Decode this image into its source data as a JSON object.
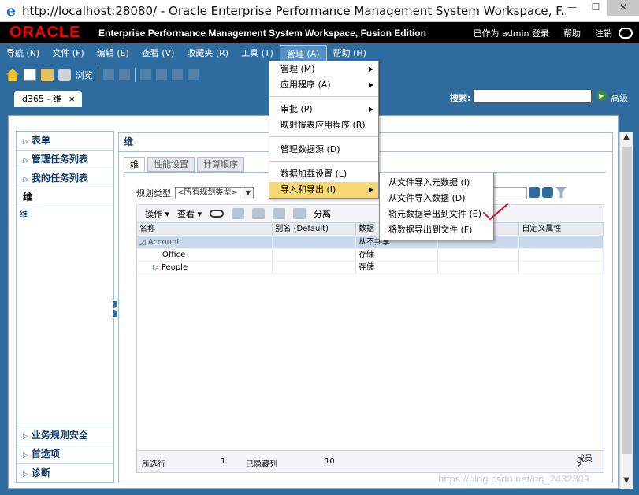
{
  "window": {
    "title": "http://localhost:28080/ - Oracle Enterprise Performance Management System Workspace, F..."
  },
  "header": {
    "logo": "ORACLE",
    "app_title": "Enterprise Performance Management System Workspace, Fusion Edition",
    "user_status": "已作为 admin 登录",
    "help": "帮助",
    "logout": "注销"
  },
  "menubar": [
    {
      "label": "导航 (N)"
    },
    {
      "label": "文件 (F)"
    },
    {
      "label": "编辑 (E)"
    },
    {
      "label": "查看 (V)"
    },
    {
      "label": "收藏夹 (R)"
    },
    {
      "label": "工具 (T)"
    },
    {
      "label": "管理 (A)"
    },
    {
      "label": "帮助 (H)"
    }
  ],
  "toolbar": {
    "browse": "浏览"
  },
  "tabs": {
    "doc_tab": "d365 - 维",
    "close": "×",
    "search_label": "搜索:",
    "advanced": "高级"
  },
  "leftnav": {
    "items": [
      "表单",
      "管理任务列表",
      "我的任务列表"
    ],
    "current": "维",
    "current_sub": "维",
    "bottom": [
      "业务规则安全",
      "首选项",
      "诊断"
    ]
  },
  "panel": {
    "title": "维",
    "subtabs": [
      "维",
      "性能设置",
      "计算顺序"
    ],
    "plan_type_label": "规划类型",
    "plan_type_value": "<所有规划类型>"
  },
  "grid_toolbar": {
    "actions": "操作",
    "view": "查看",
    "detach": "分离"
  },
  "grid": {
    "columns": [
      "名称",
      "别名 (Default)",
      "数据",
      "",
      "自定义属性"
    ],
    "rows": [
      {
        "name": "Account",
        "alias": "",
        "storage": "从不共享",
        "selected": true
      },
      {
        "name": "Office",
        "alias": "",
        "storage": "存储",
        "selected": false
      },
      {
        "name": "People",
        "alias": "",
        "storage": "存储",
        "selected": false
      }
    ],
    "footer": {
      "selected_label": "所选行",
      "selected_count": "1",
      "hidden_label": "已隐藏列",
      "hidden_count": "10",
      "members_label": "成员",
      "members_count": "2"
    }
  },
  "menu": {
    "items": [
      "管理 (M)",
      "应用程序 (A)",
      "审批 (P)",
      "映射报表应用程序 (R)",
      "管理数据源 (D)",
      "数据加载设置 (L)",
      "导入和导出 (I)"
    ],
    "submenu": [
      "从文件导入元数据 (I)",
      "从文件导入数据 (D)",
      "将元数据导出到文件 (E)",
      "将数据导出到文件 (F)"
    ]
  },
  "watermark": "https://blog.csdn.net/qq_2432809"
}
